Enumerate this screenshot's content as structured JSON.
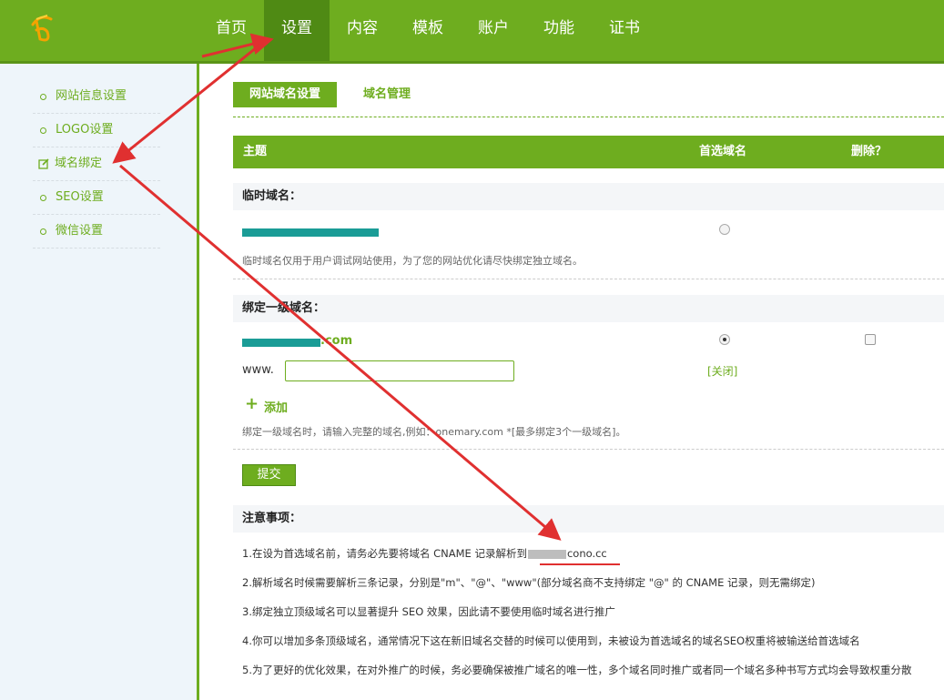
{
  "header": {
    "logo_text": "",
    "nav": [
      "首页",
      "设置",
      "内容",
      "模板",
      "账户",
      "功能",
      "证书"
    ],
    "active_index": 1
  },
  "sidebar": {
    "items": [
      {
        "label": "网站信息设置"
      },
      {
        "label": "LOGO设置"
      },
      {
        "label": "域名绑定"
      },
      {
        "label": "SEO设置"
      },
      {
        "label": "微信设置"
      }
    ],
    "active_index": 2
  },
  "tabs": {
    "active": "网站域名设置",
    "other": "域名管理"
  },
  "table": {
    "col_subject": "主题",
    "col_preferred": "首选域名",
    "col_delete": "删除？"
  },
  "temp_domain": {
    "heading": "临时域名：",
    "note": "临时域名仅用于用户调试网站使用，为了您的网站优化请尽快绑定独立域名。"
  },
  "primary_domain": {
    "heading": "绑定一级域名：",
    "domain_suffix": ".com",
    "www_label": "www.",
    "www_value": "",
    "close_label": "[关闭]",
    "add_label": "添加",
    "note": "绑定一级域名时，请输入完整的域名,例如：onemary.com  *[最多绑定3个一级域名]。"
  },
  "submit_label": "提交",
  "notice": {
    "title": "注意事项：",
    "line1_prefix": "1.在设为首选域名前，请务必先要将域名 CNAME 记录解析到",
    "line1_domain": "cono.cc",
    "lines": [
      "2.解析域名时候需要解析三条记录，分别是\"m\"、\"@\"、\"www\"(部分域名商不支持绑定 \"@\" 的 CNAME 记录，则无需绑定)",
      "3.绑定独立顶级域名可以显著提升 SEO 效果，因此请不要使用临时域名进行推广",
      "4.你可以增加多条顶级域名，通常情况下这在新旧域名交替的时候可以使用到，未被设为首选域名的域名SEO权重将被输送给首选域名",
      "5.为了更好的优化效果，在对外推广的时候，务必要确保被推广域名的唯一性，多个域名同时推广或者同一个域名多种书写方式均会导致权重分散"
    ]
  },
  "colors": {
    "brand_green": "#6ead1f",
    "mask_teal": "#1a9c96",
    "annotation_red": "#e03030"
  }
}
